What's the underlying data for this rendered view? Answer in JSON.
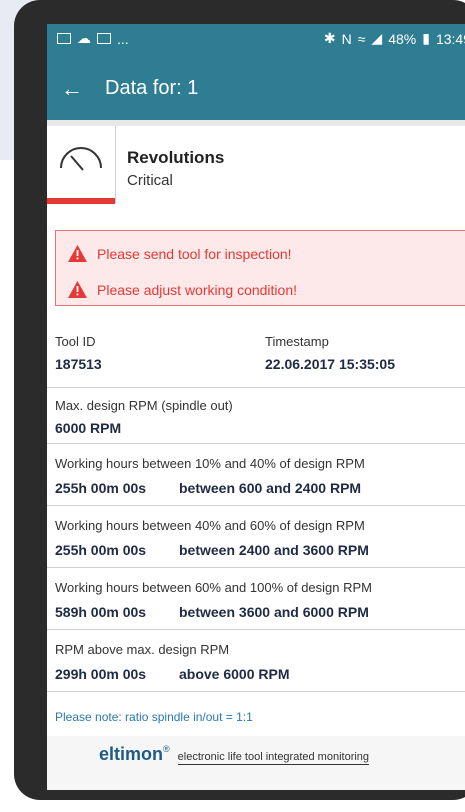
{
  "status_bar": {
    "battery": "48%",
    "time": "13:49",
    "notifications": "..."
  },
  "app_bar": {
    "title": "Data for: 1"
  },
  "sensor": {
    "name": "Revolutions",
    "status": "Critical"
  },
  "alerts": [
    {
      "text": "Please send tool for inspection!"
    },
    {
      "text": "Please adjust working condition!"
    }
  ],
  "tool": {
    "id_label": "Tool ID",
    "id_value": "187513",
    "ts_label": "Timestamp",
    "ts_value": "22.06.2017 15:35:05"
  },
  "design": {
    "label": "Max. design RPM (spindle out)",
    "value": "6000 RPM"
  },
  "ranges": [
    {
      "label": "Working hours between 10% and 40% of design RPM",
      "hours": "255h 00m 00s",
      "range": "between 600 and 2400 RPM"
    },
    {
      "label": "Working hours between 40% and 60% of design RPM",
      "hours": "255h 00m 00s",
      "range": "between 2400 and 3600 RPM"
    },
    {
      "label": "Working hours between 60% and 100% of design RPM",
      "hours": "589h 00m 00s",
      "range": "between 3600 and 6000 RPM"
    },
    {
      "label": "RPM above max. design RPM",
      "hours": "299h 00m 00s",
      "range": "above 6000 RPM"
    }
  ],
  "note": "Please note: ratio spindle in/out = 1:1",
  "footer": {
    "brand": "eltimon",
    "reg": "®",
    "tagline": "electronic life tool integrated monitoring"
  },
  "colors": {
    "appbar": "#2f7d92",
    "alert": "#e53935",
    "value_text": "#1f2a44"
  }
}
